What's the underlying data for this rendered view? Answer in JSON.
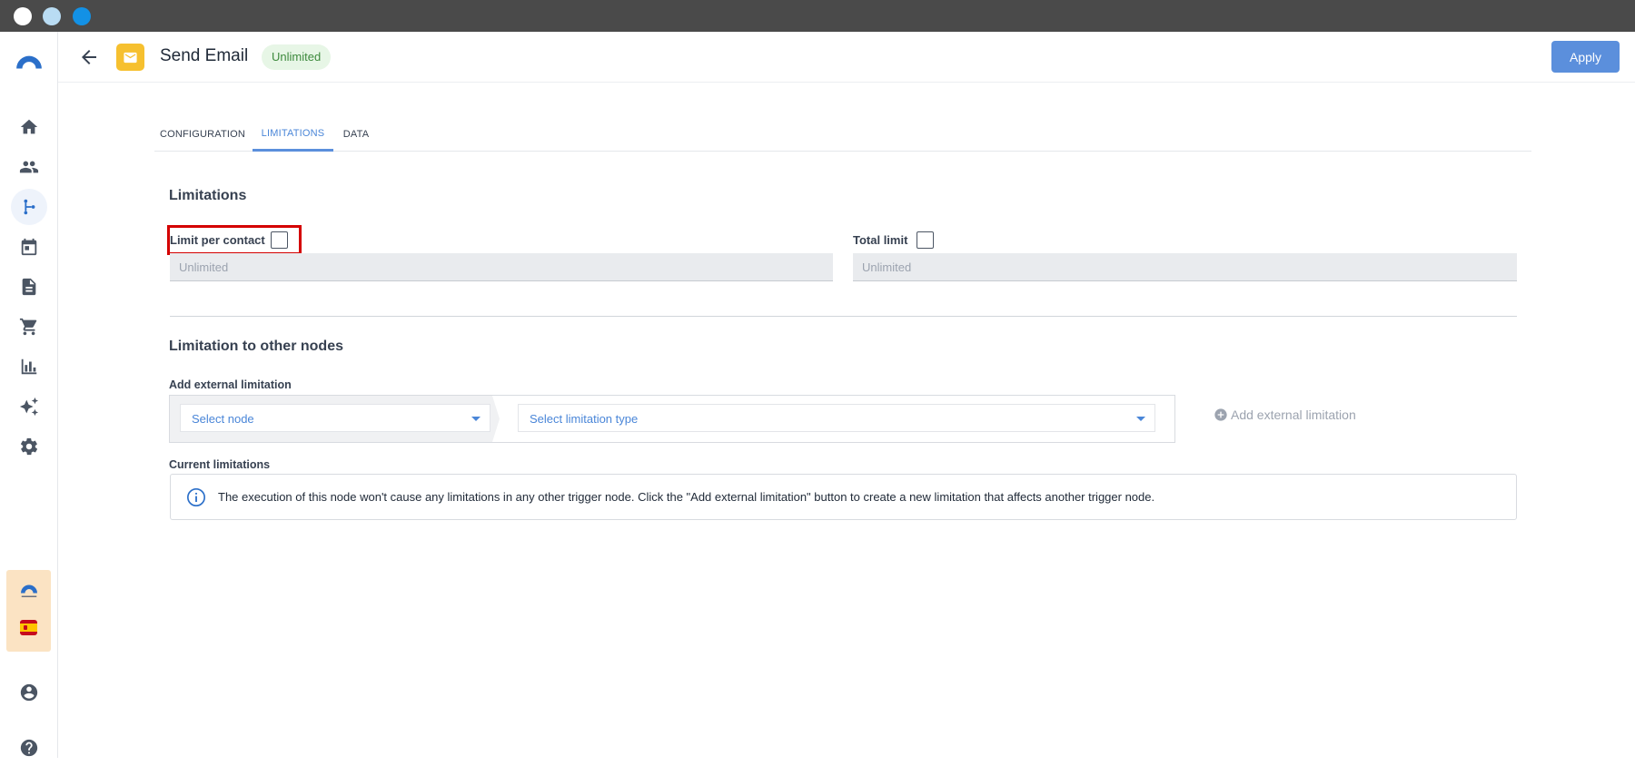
{
  "window": {
    "dots": [
      "#ffffff",
      "#b9dcf3",
      "#1391e5"
    ]
  },
  "sidebar": {
    "logo": "brand-arch-icon",
    "items": [
      {
        "icon": "home-icon",
        "label": "Home"
      },
      {
        "icon": "people-icon",
        "label": "Contacts"
      },
      {
        "icon": "workflow-icon",
        "label": "Workflows",
        "active": true
      },
      {
        "icon": "calendar-icon",
        "label": "Calendar"
      },
      {
        "icon": "document-icon",
        "label": "Documents"
      },
      {
        "icon": "cart-icon",
        "label": "Shop"
      },
      {
        "icon": "chart-icon",
        "label": "Analytics"
      },
      {
        "icon": "sparkle-icon",
        "label": "AI"
      },
      {
        "icon": "gear-icon",
        "label": "Settings"
      }
    ],
    "account_icon": "account-icon",
    "help_icon": "help-icon"
  },
  "header": {
    "back_icon": "arrow-left-icon",
    "node_icon": "email-icon",
    "title": "Send Email",
    "badge": "Unlimited",
    "apply_label": "Apply",
    "accent": "#5b8fdc"
  },
  "tabs": [
    {
      "label": "CONFIGURATION",
      "active": false
    },
    {
      "label": "LIMITATIONS",
      "active": true
    },
    {
      "label": "DATA",
      "active": false
    }
  ],
  "limitations": {
    "heading": "Limitations",
    "per_contact_label": "Limit per contact",
    "per_contact_checked": false,
    "per_contact_placeholder": "Unlimited",
    "total_label": "Total limit",
    "total_checked": false,
    "total_placeholder": "Unlimited"
  },
  "other_nodes": {
    "heading": "Limitation to other nodes",
    "add_label": "Add external limitation",
    "select_node": "Select node",
    "select_type": "Select limitation type",
    "add_button": "Add external limitation",
    "current_label": "Current limitations",
    "info_text": "The execution of this node won't cause any limitations in any other trigger node. Click the \"Add external limitation\" button to create a new limitation that affects another trigger node."
  }
}
